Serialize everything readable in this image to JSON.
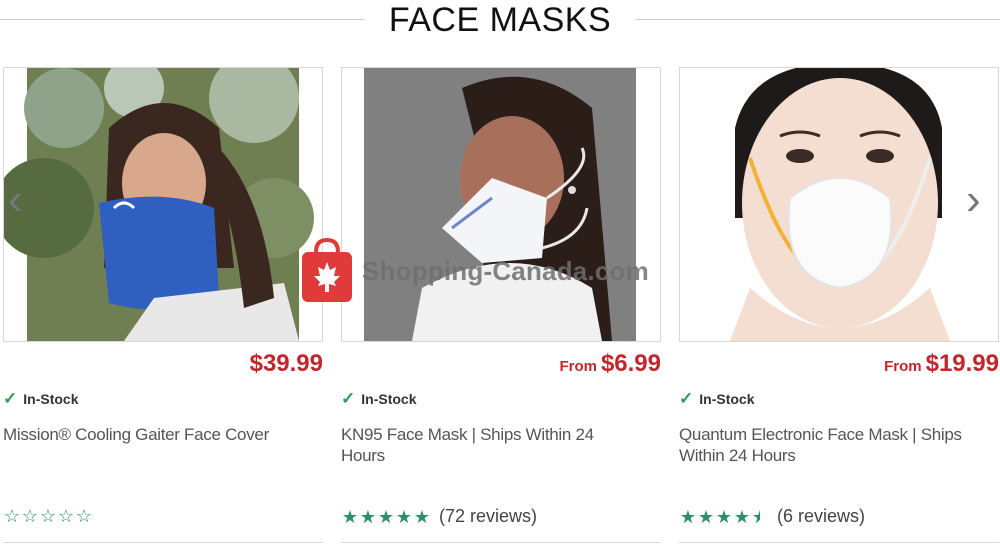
{
  "header": {
    "title": "FACE MASKS"
  },
  "nav": {
    "prev_glyph": "‹",
    "next_glyph": "›"
  },
  "watermark": {
    "text": "Shopping-Canada.com"
  },
  "products": [
    {
      "image_icon": "neck-gaiter-photo",
      "price_prefix": "",
      "price": "$39.99",
      "stock": "In-Stock",
      "name": "Mission® Cooling Gaiter Face Cover",
      "rating": 0,
      "reviews": ""
    },
    {
      "image_icon": "kn95-mask-photo",
      "price_prefix": "From",
      "price": "$6.99",
      "stock": "In-Stock",
      "name": "KN95 Face Mask | Ships Within 24 Hours",
      "rating": 5,
      "reviews": "(72 reviews)"
    },
    {
      "image_icon": "electronic-mask-photo",
      "price_prefix": "From",
      "price": "$19.99",
      "stock": "In-Stock",
      "name": "Quantum Electronic Face Mask | Ships Within 24 Hours",
      "rating": 4.5,
      "reviews": "(6 reviews)"
    }
  ],
  "colors": {
    "price": "#c1272d",
    "star": "#2e8f6f",
    "check": "#2e9e4f"
  }
}
